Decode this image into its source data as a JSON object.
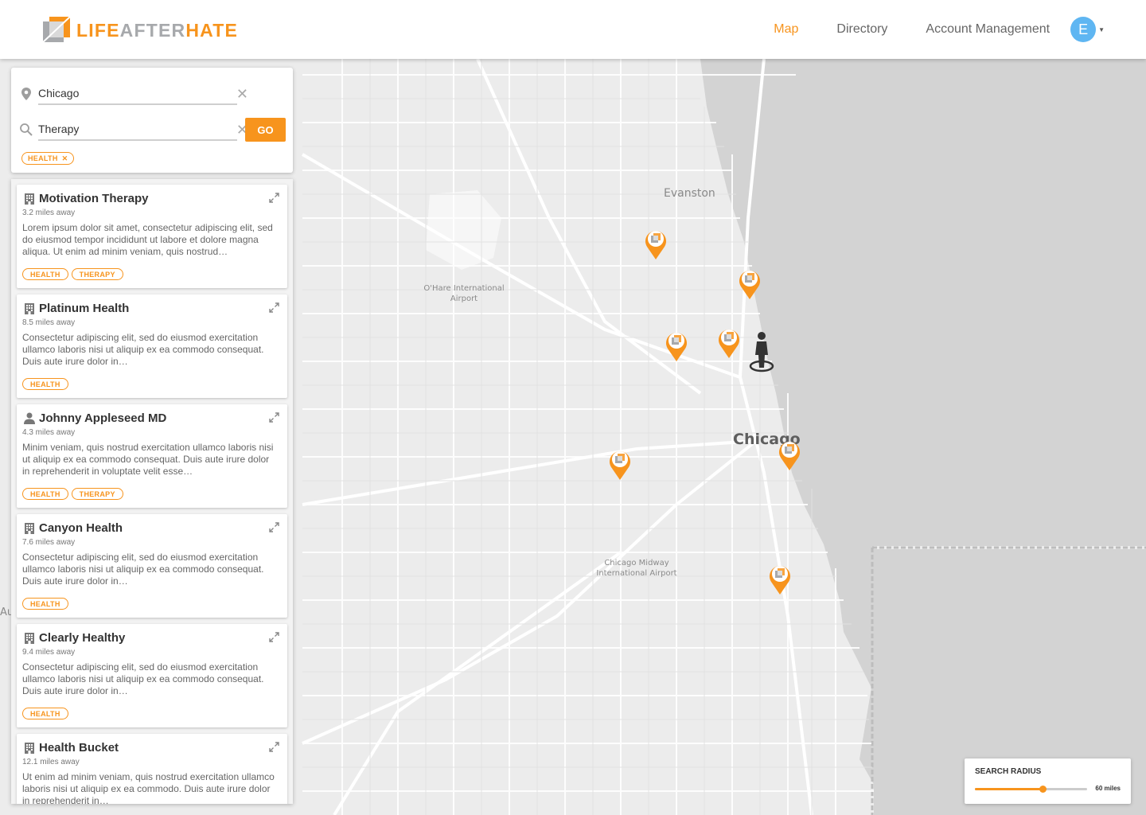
{
  "brand": {
    "part1": "LIFE",
    "part2": "AFTER",
    "part3": "HATE"
  },
  "nav": {
    "items": [
      {
        "label": "Map",
        "active": true
      },
      {
        "label": "Directory",
        "active": false
      },
      {
        "label": "Account Management",
        "active": false
      }
    ],
    "avatar_initial": "E"
  },
  "search": {
    "location_value": "Chicago",
    "query_value": "Therapy",
    "go_label": "GO",
    "active_filters": [
      "HEALTH"
    ]
  },
  "results": [
    {
      "type": "organization",
      "title": "Motivation Therapy",
      "distance": "3.2 miles away",
      "description": "Lorem ipsum dolor sit amet, consectetur adipiscing elit, sed do eiusmod tempor incididunt ut labore et dolore magna aliqua. Ut enim ad minim veniam, quis nostrud…",
      "tags": [
        "HEALTH",
        "THERAPY"
      ]
    },
    {
      "type": "organization",
      "title": "Platinum Health",
      "distance": "8.5 miles away",
      "description": "Consectetur adipiscing elit, sed do eiusmod exercitation ullamco laboris nisi ut aliquip ex ea commodo consequat. Duis aute irure dolor in…",
      "tags": [
        "HEALTH"
      ]
    },
    {
      "type": "person",
      "title": "Johnny Appleseed MD",
      "distance": "4.3 miles away",
      "description": "Minim veniam, quis nostrud exercitation ullamco laboris nisi ut aliquip ex ea commodo consequat. Duis aute irure dolor in reprehenderit in voluptate velit esse…",
      "tags": [
        "HEALTH",
        "THERAPY"
      ]
    },
    {
      "type": "organization",
      "title": "Canyon Health",
      "distance": "7.6 miles away",
      "description": "Consectetur adipiscing elit, sed do eiusmod exercitation ullamco laboris nisi ut aliquip ex ea commodo consequat. Duis aute irure dolor in…",
      "tags": [
        "HEALTH"
      ]
    },
    {
      "type": "organization",
      "title": "Clearly Healthy",
      "distance": "9.4 miles away",
      "description": "Consectetur adipiscing elit, sed do eiusmod exercitation ullamco laboris nisi ut aliquip ex ea commodo consequat. Duis aute irure dolor in…",
      "tags": [
        "HEALTH"
      ]
    },
    {
      "type": "organization",
      "title": "Health Bucket",
      "distance": "12.1 miles away",
      "description": "Ut enim ad minim veniam, quis nostrud exercitation ullamco laboris nisi ut aliquip ex ea commodo. Duis aute irure dolor in reprehenderit in…",
      "tags": []
    }
  ],
  "map": {
    "labels": {
      "evanston": "Evanston",
      "ohare": "O'Hare International Airport",
      "midway": "Chicago Midway International Airport",
      "chicago": "Chicago",
      "au": "Au"
    },
    "pin_count": 7
  },
  "radius": {
    "title": "SEARCH RADIUS",
    "value_label": "60 miles",
    "fraction": 0.6
  },
  "colors": {
    "accent": "#f7941d",
    "avatar": "#5fb6f2",
    "lake": "#d3d3d3",
    "land": "#ececec"
  },
  "icons": {
    "location": "location-pin-icon",
    "search": "search-icon",
    "clear": "clear-icon",
    "organization": "building-icon",
    "person": "person-icon",
    "expand": "expand-icon"
  }
}
